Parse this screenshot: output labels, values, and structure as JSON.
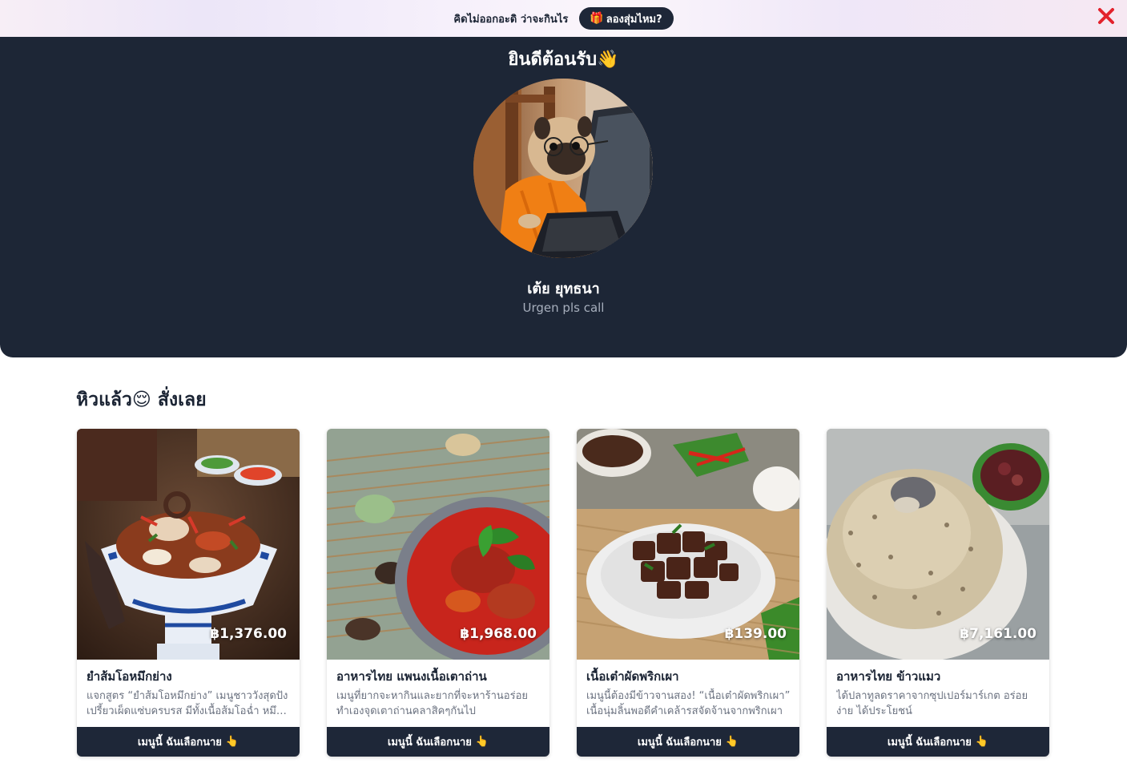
{
  "promo": {
    "text": "คิดไม่ออกอะดิ ว่าจะกินไร",
    "button_icon": "🎁",
    "button_label": "ลองสุ่มไหม?",
    "close_icon": "close-icon",
    "close_color": "#e3222c"
  },
  "hero": {
    "welcome": "ยินดีต้อนรับ👋",
    "name": "เต้ย ยุทธนา",
    "status": "Urgen pls call",
    "background": "#1d2636"
  },
  "section": {
    "title": "หิวแล้ว😌 สั่งเลย"
  },
  "cards": [
    {
      "title": "ยำส้มโอหมึกย่าง",
      "price": "฿1,376.00",
      "description": "แจกสูตร “ยำส้มโอหมึกย่าง” เมนูชาววังสุดปัง เปรี้ยวเผ็ดแซ่บครบรส มีทั้งเนื้อส้มโอฉ่ำ หมึกย่างหอมๆ",
      "button_label": "เมนูนี้ ฉันเลือกนาย",
      "button_icon": "👆"
    },
    {
      "title": "อาหารไทย แพนงเนื้อเตาถ่าน",
      "price": "฿1,968.00",
      "description": "เมนูที่ยากจะหากินและยากที่จะหาร้านอร่อย ทำเองจุดเตาถ่านคลาสิคๆกันไป",
      "button_label": "เมนูนี้ ฉันเลือกนาย",
      "button_icon": "👆"
    },
    {
      "title": "เนื้อเต๋าผัดพริกเผา",
      "price": "฿139.00",
      "description": "เมนูนี้ต้องมีข้าวจานสอง! “เนื้อเต๋าผัดพริกเผา” เนื้อนุ่มลิ้นพอดีคำเคล้ารสจัดจ้านจากพริกเผา",
      "button_label": "เมนูนี้ ฉันเลือกนาย",
      "button_icon": "👆"
    },
    {
      "title": "อาหารไทย ข้าวแมว",
      "price": "฿7,161.00",
      "description": "ได้ปลาทูลดราคาจากซุปเปอร์มาร์เกต อร่อยง่าย ได้ประโยชน์",
      "button_label": "เมนูนี้ ฉันเลือกนาย",
      "button_icon": "👆"
    }
  ]
}
